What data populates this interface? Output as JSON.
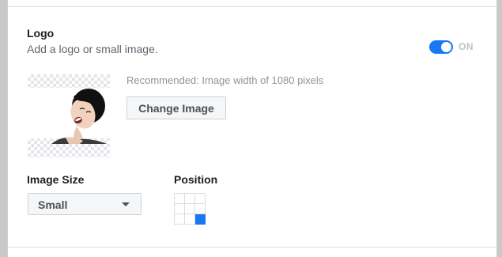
{
  "logo": {
    "title": "Logo",
    "subtitle": "Add a logo or small image.",
    "toggle_label": "ON",
    "toggle_on": true
  },
  "image": {
    "recommendation": "Recommended: Image width of 1080 pixels",
    "change_button_label": "Change Image"
  },
  "image_size": {
    "label": "Image Size",
    "selected": "Small"
  },
  "position": {
    "label": "Position",
    "selected_cell": "bottom-right"
  },
  "colors": {
    "accent": "#1877f2",
    "text_primary": "#1c1e21",
    "text_secondary": "#606770",
    "text_muted": "#8d949e"
  }
}
